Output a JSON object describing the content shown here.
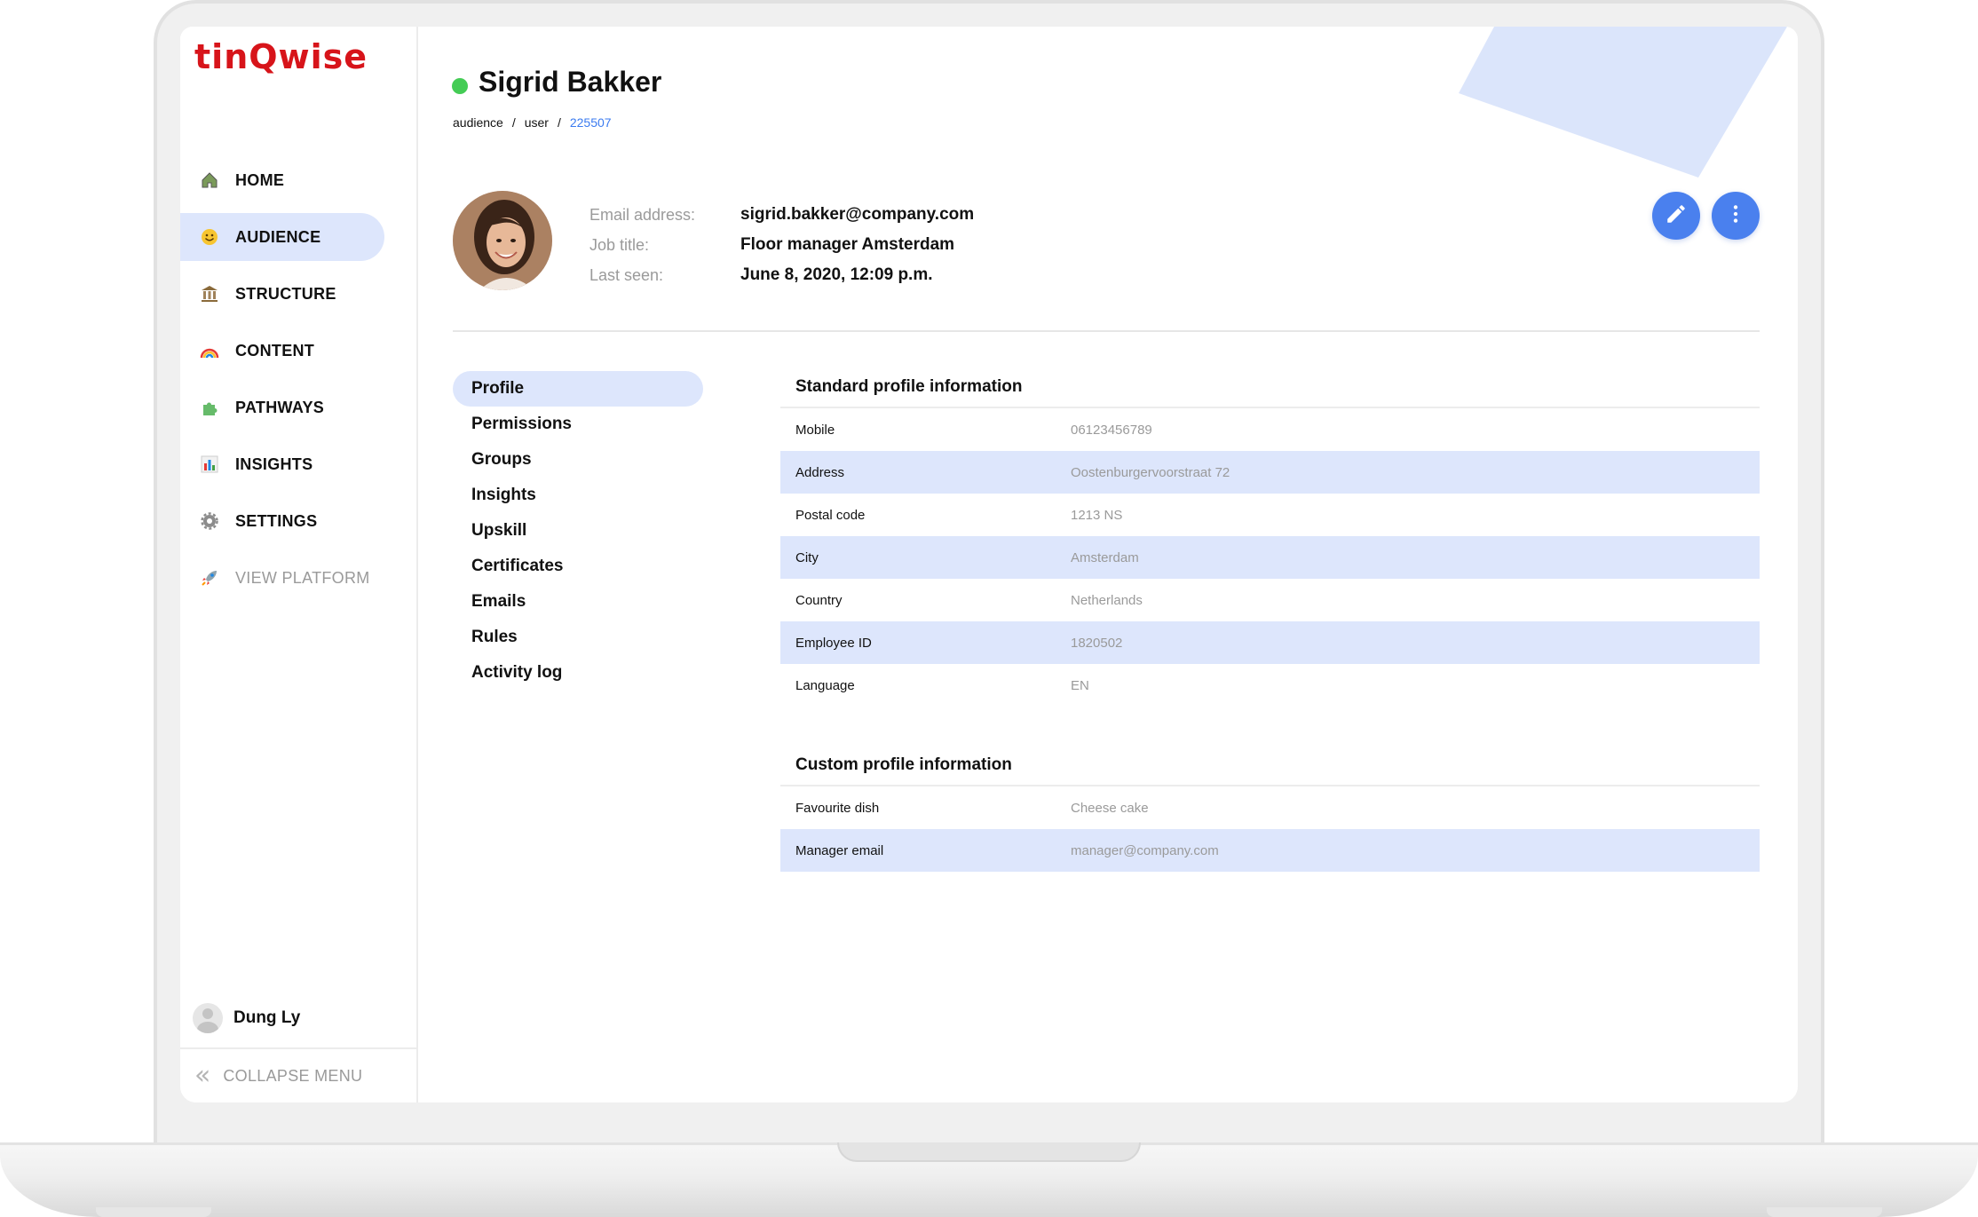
{
  "brand": {
    "logo_text": "tinQwise",
    "logo_color": "#d7141a",
    "accent": "#4a80ee",
    "highlight": "#dde6fc"
  },
  "sidebar": {
    "items": [
      {
        "label": "HOME",
        "icon": "house-icon"
      },
      {
        "label": "AUDIENCE",
        "icon": "smiley-icon",
        "active": true
      },
      {
        "label": "STRUCTURE",
        "icon": "building-icon"
      },
      {
        "label": "CONTENT",
        "icon": "rainbow-icon"
      },
      {
        "label": "PATHWAYS",
        "icon": "puzzle-icon"
      },
      {
        "label": "INSIGHTS",
        "icon": "bar-chart-icon"
      },
      {
        "label": "SETTINGS",
        "icon": "gear-icon"
      },
      {
        "label": "VIEW PLATFORM",
        "icon": "rocket-icon"
      }
    ],
    "user_name": "Dung Ly",
    "collapse_label": "COLLAPSE MENU"
  },
  "header": {
    "title": "Sigrid Bakker",
    "status": "online",
    "breadcrumb": {
      "part1": "audience",
      "sep": "/",
      "part2": "user",
      "current": "225507"
    }
  },
  "profile": {
    "email_label": "Email address:",
    "email_value": "sigrid.bakker@company.com",
    "job_label": "Job title:",
    "job_value": "Floor manager Amsterdam",
    "seen_label": "Last seen:",
    "seen_value": "June 8, 2020, 12:09 p.m."
  },
  "actions": {
    "edit_icon": "pencil-icon",
    "more_icon": "more-vertical-icon"
  },
  "subnav": [
    "Profile",
    "Permissions",
    "Groups",
    "Insights",
    "Upskill",
    "Certificates",
    "Emails",
    "Rules",
    "Activity log"
  ],
  "standard": {
    "title": "Standard profile information",
    "rows": [
      {
        "label": "Mobile",
        "value": "06123456789"
      },
      {
        "label": "Address",
        "value": "Oostenburgervoorstraat 72"
      },
      {
        "label": "Postal code",
        "value": "1213 NS"
      },
      {
        "label": "City",
        "value": "Amsterdam"
      },
      {
        "label": "Country",
        "value": "Netherlands"
      },
      {
        "label": "Employee ID",
        "value": "1820502"
      },
      {
        "label": "Language",
        "value": "EN"
      }
    ]
  },
  "custom": {
    "title": "Custom profile information",
    "rows": [
      {
        "label": "Favourite dish",
        "value": "Cheese cake"
      },
      {
        "label": "Manager email",
        "value": "manager@company.com"
      }
    ]
  }
}
